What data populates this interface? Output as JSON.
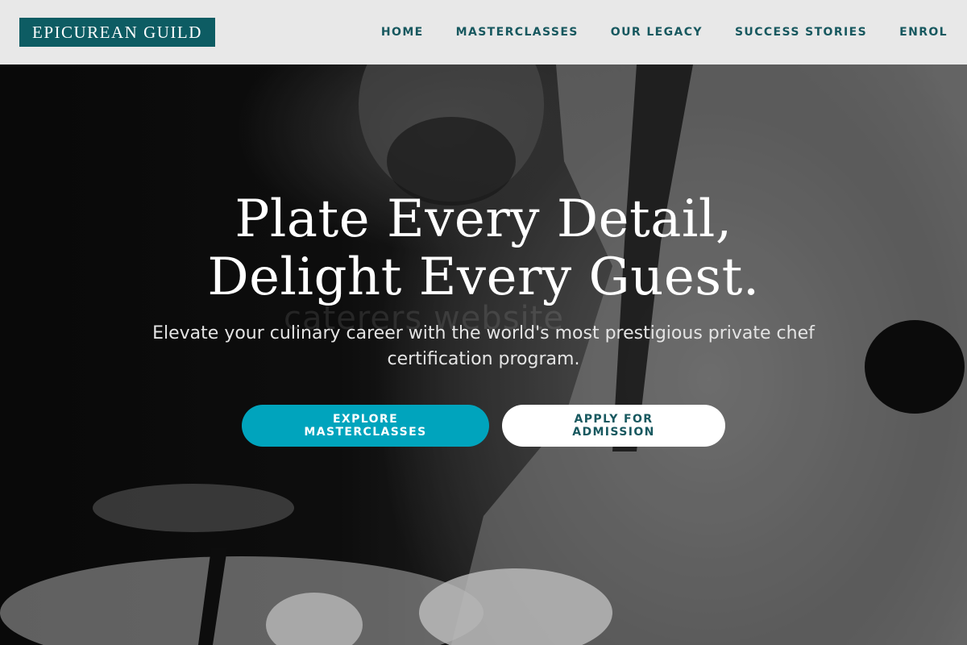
{
  "header": {
    "logo_text": "EPICUREAN GUILD",
    "nav": [
      {
        "label": "HOME"
      },
      {
        "label": "MASTERCLASSES"
      },
      {
        "label": "OUR LEGACY"
      },
      {
        "label": "SUCCESS STORIES"
      },
      {
        "label": "ENROL"
      }
    ]
  },
  "hero": {
    "headline_line1": "Plate Every Detail,",
    "headline_line2": "Delight Every Guest.",
    "subheading": "Elevate your culinary career with the world's most prestigious private chef certification program.",
    "watermark": "caterers website",
    "primary_cta": "EXPLORE MASTERCLASSES",
    "secondary_cta": "APPLY FOR ADMISSION",
    "background_image": "chef-plating-photo-monochrome"
  },
  "colors": {
    "brand_teal": "#0d5c63",
    "nav_text": "#17585f",
    "primary_button": "#00a4bd",
    "header_background": "#e8e8e8"
  }
}
